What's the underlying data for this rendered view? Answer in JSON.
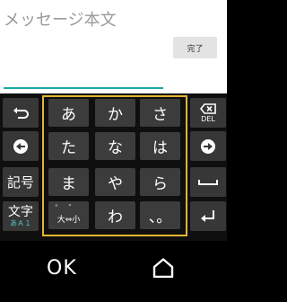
{
  "header": {
    "title": "メッセージ本文",
    "done_label": "完了"
  },
  "keyboard": {
    "del_label": "DEL",
    "symbols_label": "記号",
    "mode_label": "文字",
    "mode_sub": "あＡ１",
    "keys": [
      [
        "あ",
        "か",
        "さ"
      ],
      [
        "た",
        "な",
        "は"
      ],
      [
        "ま",
        "や",
        "ら"
      ],
      [
        "大⇔小",
        "わ",
        "、。"
      ]
    ],
    "dakuten": "゜゛"
  },
  "navbar": {
    "ok_label": "OK"
  }
}
